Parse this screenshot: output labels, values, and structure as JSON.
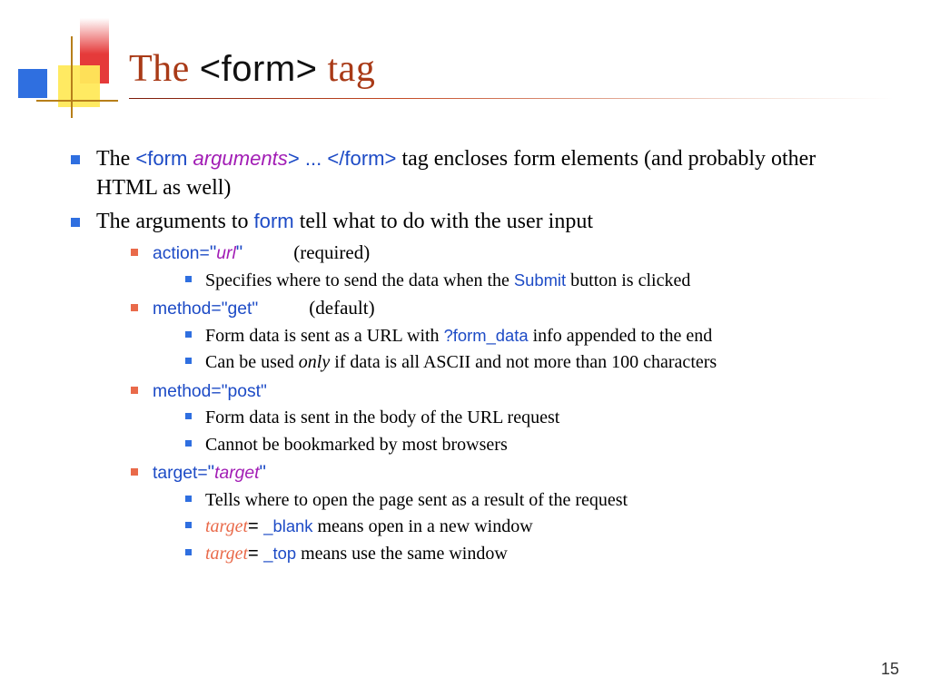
{
  "title": {
    "prefix": "The ",
    "code": "<form>",
    "suffix": " tag"
  },
  "bullets": {
    "p1": {
      "t1": "The ",
      "code1": "<form ",
      "args": "arguments",
      "code2": "> ... </form>",
      "t2": " tag encloses form elements (and probably other HTML as well)"
    },
    "p2": {
      "t1": "The arguments to ",
      "code": "form",
      "t2": " tell what to do with the user input"
    },
    "action": {
      "label": "action=",
      "q1": "\"",
      "val": "url",
      "q2": "\"",
      "note": "(required)",
      "sub": {
        "t1": "Specifies where to send the data when the  ",
        "code": "Submit",
        "t2": " button is clicked"
      }
    },
    "get": {
      "label": "method=\"get\"",
      "note": "(default)",
      "s1": {
        "t1": "Form data is sent as a URL with ",
        "code": "?form_data",
        "t2": " info appended to the end"
      },
      "s2": {
        "t1": "Can be used ",
        "ital": "only",
        "t2": " if data is all ASCII and not more than 100 characters"
      }
    },
    "post": {
      "label": "method=\"post\"",
      "s1": "Form data is sent in the body of the URL request",
      "s2": "Cannot be bookmarked by most browsers"
    },
    "target": {
      "label": "target=",
      "q1": "\"",
      "val": "target",
      "q2": "\"",
      "s1": "Tells where to open the page sent as a result of the request",
      "s2": {
        "attr": "target",
        "eq": "= ",
        "code": "_blank",
        "t": " means open in a new window"
      },
      "s3": {
        "attr": "target",
        "eq": "= ",
        "code": "_top",
        "t": " means use the same window"
      }
    }
  },
  "page": "15"
}
